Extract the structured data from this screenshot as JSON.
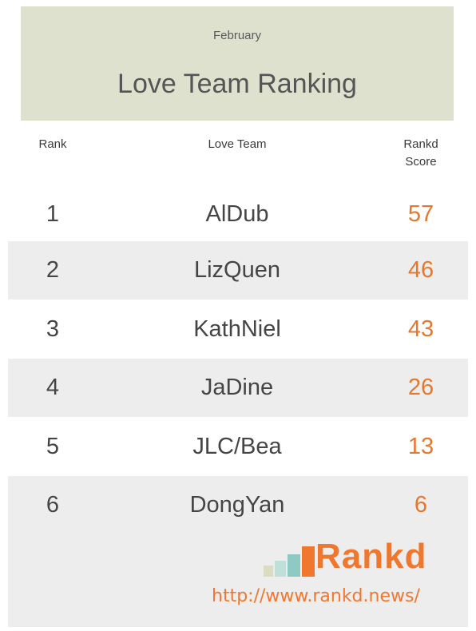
{
  "header": {
    "month": "February",
    "title": "Love Team Ranking"
  },
  "columns": {
    "rank": "Rank",
    "team": "Love Team",
    "score_line1": "Rankd",
    "score_line2": "Score"
  },
  "chart_data": {
    "type": "table",
    "title": "Love Team Ranking",
    "subtitle": "February",
    "columns": [
      "Rank",
      "Love Team",
      "Rankd Score"
    ],
    "rows": [
      {
        "rank": "1",
        "team": "AlDub",
        "score": "57"
      },
      {
        "rank": "2",
        "team": "LizQuen",
        "score": "46"
      },
      {
        "rank": "3",
        "team": "KathNiel",
        "score": "43"
      },
      {
        "rank": "4",
        "team": "JaDine",
        "score": "26"
      },
      {
        "rank": "5",
        "team": "JLC/Bea",
        "score": "13"
      },
      {
        "rank": "6",
        "team": "DongYan",
        "score": "6"
      }
    ]
  },
  "footer": {
    "brand": "Rankd",
    "url": "http://www.rankd.news/"
  },
  "colors": {
    "header_bg": "#dee1cd",
    "score": "#e8772e",
    "row_shade": "#ededed"
  }
}
